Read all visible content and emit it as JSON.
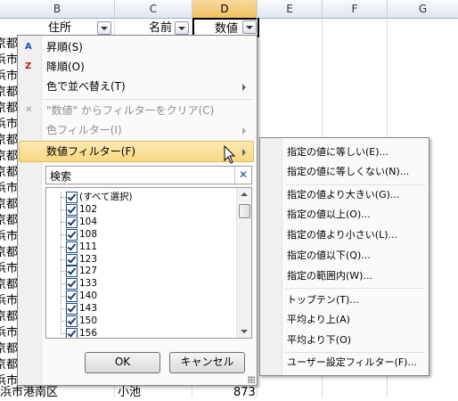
{
  "sheet": {
    "columns": [
      "B",
      "C",
      "D",
      "E",
      "F",
      "G"
    ],
    "header": {
      "b": "住所",
      "c": "名前",
      "d": "数値"
    },
    "row_values": [
      "京都",
      "浜市",
      "浜市",
      "京都",
      "京都",
      "浜市",
      "京都",
      "京都",
      "京都",
      "浜市",
      "京都",
      "京都",
      "浜市",
      "京都",
      "浜市",
      "京都",
      "浜市",
      "京都",
      "浜市",
      "京都",
      "京都",
      "浜市"
    ],
    "last_row": {
      "b": "浜市港南区",
      "c": "小池",
      "d": "873"
    }
  },
  "menu": {
    "items": [
      {
        "label": "昇順(S)",
        "icon": "sort-ascending-icon",
        "glyph": "A↓Z"
      },
      {
        "label": "降順(O)",
        "icon": "sort-descending-icon",
        "glyph": "Z↓A"
      },
      {
        "label": "色で並べ替え(T)",
        "submenu": true
      },
      {
        "label": "\"数値\" からフィルターをクリア(C)",
        "disabled": true,
        "icon": "clear-filter-icon",
        "glyph": "✕"
      },
      {
        "label": "色フィルター(I)",
        "disabled": true,
        "submenu": true
      },
      {
        "label": "数値フィルター(F)",
        "submenu": true,
        "highlighted": true
      }
    ],
    "search_placeholder": "検索",
    "list_items": [
      "(すべて選択)",
      "102",
      "104",
      "108",
      "111",
      "123",
      "127",
      "133",
      "140",
      "143",
      "150",
      "156"
    ],
    "ok_label": "OK",
    "cancel_label": "キャンセル"
  },
  "submenu": {
    "items": [
      "指定の値に等しい(E)...",
      "指定の値に等しくない(N)...",
      "指定の値より大きい(G)...",
      "指定の値以上(O)...",
      "指定の値より小さい(L)...",
      "指定の値以下(Q)...",
      "指定の範囲内(W)...",
      "トップテン(T)...",
      "平均より上(A)",
      "平均より下(O)",
      "ユーザー設定フィルター(F)..."
    ]
  },
  "colors": {
    "highlight": "#f7d780",
    "selected_column": "#f1c15f",
    "menu_border": "#868686"
  }
}
